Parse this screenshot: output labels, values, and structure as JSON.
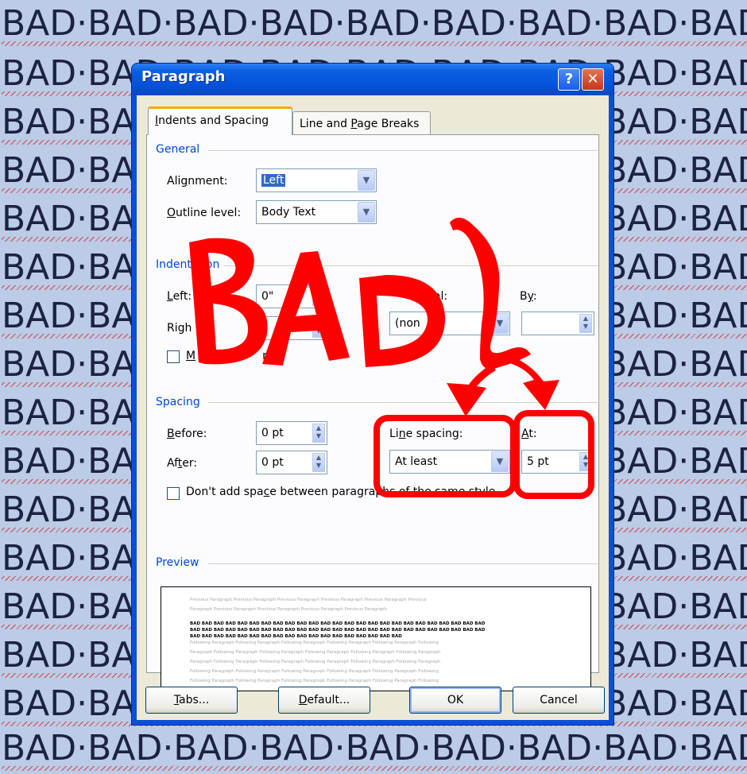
{
  "background": {
    "repeated_text": "BAD·BAD·BAD·BAD·BAD·BAD·BAD·BAD·BAD",
    "left_fragment": "BAD·BA",
    "right_fragment": "AD·BAD",
    "color": "#1c2340",
    "bg_color": "#bccbe6"
  },
  "dialog": {
    "title": "Paragraph",
    "help_glyph": "?",
    "close_glyph": "✕"
  },
  "tabs": {
    "active_pre": "",
    "active_u": "I",
    "active_post": "ndents and Spacing",
    "inactive_pre": "Line and ",
    "inactive_u": "P",
    "inactive_post": "age Breaks"
  },
  "general": {
    "heading": "General",
    "alignment_pre": "Ali",
    "alignment_u": "g",
    "alignment_post": "nment:",
    "alignment_value": "Left",
    "outline_pre": "",
    "outline_u": "O",
    "outline_post": "utline level:",
    "outline_value": "Body Text"
  },
  "indentation": {
    "heading_visible": "Indent",
    "heading_tail": "on",
    "left_pre": "",
    "left_u": "L",
    "left_post": "eft:",
    "left_value": "0\"",
    "right_pre": "Righ",
    "right_value": "\"",
    "special_tail": "ial:",
    "special_value": "(non",
    "by_pre": "B",
    "by_u": "y",
    "by_post": ":",
    "by_value": "",
    "mirror_u": "M",
    "mirror_tail": "nts"
  },
  "spacing": {
    "heading": "Spacing",
    "before_pre": "",
    "before_u": "B",
    "before_post": "efore:",
    "before_value": "0 pt",
    "after_pre": "Af",
    "after_u": "t",
    "after_post": "er:",
    "after_value": "0 pt",
    "line_pre": "Li",
    "line_u": "n",
    "line_post": "e spacing:",
    "line_value": "At least",
    "at_pre": "",
    "at_u": "A",
    "at_post": "t:",
    "at_value": "5 pt",
    "dont_add_pre": "Don't add spa",
    "dont_add_u": "c",
    "dont_add_post": "e between paragraphs of the same style"
  },
  "preview": {
    "heading": "Preview",
    "prev_line1": "Previous Paragraph Previous Paragraph Previous Paragraph Previous Paragraph Previous Paragraph Previous",
    "prev_line2": "Paragraph Previous Paragraph Previous Paragraph Previous Paragraph Previous Paragraph",
    "bad_line1": "BAD BAD BAD BAD BAD BAD BAD BAD BAD BAD BAD BAD BAD BAD BAD BAD BAD BAD BAD BAD BAD BAD BAD BAD BAD",
    "bad_line2": "BAD BAD BAD BAD BAD BAD BAD BAD BAD BAD BAD BAD BAD BAD BAD BAD BAD BAD BAD BAD BAD BAD BAD BAD BAD",
    "bad_line3": "BAD BAD BAD BAD BAD BAD BAD BAD BAD BAD BAD BAD BAD BAD BAD BAD BAD BAD",
    "follow_line1": "Following Paragraph Following Paragraph Following Paragraph Following Paragraph Following Paragraph Following",
    "follow_line2": "Paragraph Following Paragraph Following Paragraph Following Paragraph Following Paragraph Following Paragraph",
    "follow_line3": "Paragraph Following Paragraph Following Paragraph Following Paragraph Following Paragraph Following Paragraph",
    "follow_line4": "Following Paragraph Following Paragraph Following Paragraph Following Paragraph Following Paragraph Following"
  },
  "buttons": {
    "tabs_u": "T",
    "tabs_post": "abs...",
    "default_u": "D",
    "default_post": "efault...",
    "ok": "OK",
    "cancel": "Cancel"
  },
  "annotation": {
    "text": "BAD",
    "color": "#ff0000"
  }
}
